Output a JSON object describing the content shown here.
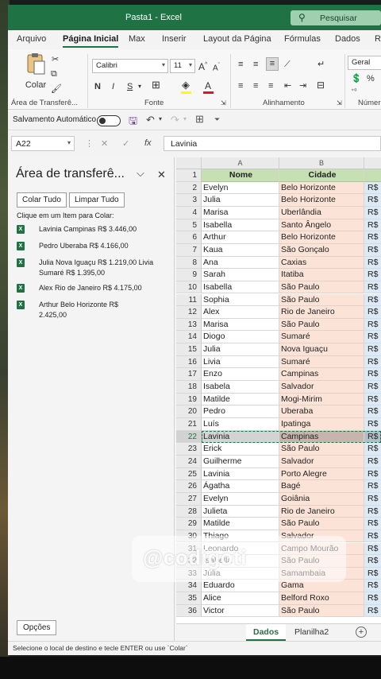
{
  "window": {
    "title": "Pasta1  -  Excel"
  },
  "search": {
    "label": "Pesquisar"
  },
  "ribbon_tabs": [
    "Arquivo",
    "Página Inicial",
    "Max",
    "Inserir",
    "Layout da Página",
    "Fórmulas",
    "Dados",
    "R"
  ],
  "ribbon": {
    "paste_label": "Colar",
    "font_name": "Calibri",
    "font_size": "11",
    "number_format": "Geral",
    "groups": {
      "clipboard": "Área de Transferê...",
      "font": "Fonte",
      "alignment": "Alinhamento",
      "number": "Número"
    },
    "bold": "N",
    "italic": "I",
    "underline": "S",
    "font_grow": "A",
    "font_shrink": "A",
    "font_color_letter": "A"
  },
  "qat": {
    "autosave_label": "Salvamento Automático"
  },
  "formula_bar": {
    "name_box": "A22",
    "cancel": "✕",
    "enter": "✓",
    "fx": "fx",
    "formula": "Lavinia"
  },
  "clipboard_pane": {
    "title": "Área de transferê...",
    "paste_all": "Colar Tudo",
    "clear_all": "Limpar Tudo",
    "hint": "Clique em um Item para Colar:",
    "items": [
      {
        "text": "Lavinia Campinas R$ 3.446,00"
      },
      {
        "text": "Pedro Uberaba R$ 4.166,00"
      },
      {
        "text": "Julia Nova Iguaçu R$ 1.219,00 Livia Sumaré R$ 1.395,00"
      },
      {
        "text": "Alex Rio de Janeiro R$ 4.175,00"
      },
      {
        "text": "Arthur Belo Horizonte R$ 2.425,00"
      }
    ],
    "options": "Opções"
  },
  "grid": {
    "columns": [
      "A",
      "B"
    ],
    "header": {
      "row": "1",
      "a": "Nome",
      "b": "Cidade"
    },
    "currency": "R$",
    "selected_row": "22",
    "rows": [
      {
        "n": "2",
        "a": "Evelyn",
        "b": "Belo Horizonte"
      },
      {
        "n": "3",
        "a": "Julia",
        "b": "Belo Horizonte"
      },
      {
        "n": "4",
        "a": "Marisa",
        "b": "Uberlândia"
      },
      {
        "n": "5",
        "a": "Isabella",
        "b": "Santo Ângelo"
      },
      {
        "n": "6",
        "a": "Arthur",
        "b": "Belo Horizonte"
      },
      {
        "n": "7",
        "a": "Kaua",
        "b": "São Gonçalo"
      },
      {
        "n": "8",
        "a": "Ana",
        "b": "Caxias"
      },
      {
        "n": "9",
        "a": "Sarah",
        "b": "Itatiba"
      },
      {
        "n": "10",
        "a": "Isabella",
        "b": "São Paulo"
      },
      {
        "n": "11",
        "a": "Sophia",
        "b": "São Paulo"
      },
      {
        "n": "12",
        "a": "Alex",
        "b": "Rio de Janeiro"
      },
      {
        "n": "13",
        "a": "Marisa",
        "b": "São Paulo"
      },
      {
        "n": "14",
        "a": "Diogo",
        "b": "Sumaré"
      },
      {
        "n": "15",
        "a": "Julia",
        "b": "Nova Iguaçu"
      },
      {
        "n": "16",
        "a": "Livia",
        "b": "Sumaré"
      },
      {
        "n": "17",
        "a": "Enzo",
        "b": "Campinas"
      },
      {
        "n": "18",
        "a": "Isabela",
        "b": "Salvador"
      },
      {
        "n": "19",
        "a": "Matilde",
        "b": "Mogi-Mirim"
      },
      {
        "n": "20",
        "a": "Pedro",
        "b": "Uberaba"
      },
      {
        "n": "21",
        "a": "Luís",
        "b": "Ipatinga"
      },
      {
        "n": "22",
        "a": "Lavinia",
        "b": "Campinas"
      },
      {
        "n": "23",
        "a": "Erick",
        "b": "São Paulo"
      },
      {
        "n": "24",
        "a": "Guilherme",
        "b": "Salvador"
      },
      {
        "n": "25",
        "a": "Lavinia",
        "b": "Porto Alegre"
      },
      {
        "n": "26",
        "a": "Ágatha",
        "b": "Bagé"
      },
      {
        "n": "27",
        "a": "Evelyn",
        "b": "Goiânia"
      },
      {
        "n": "28",
        "a": "Julieta",
        "b": "Rio de Janeiro"
      },
      {
        "n": "29",
        "a": "Matilde",
        "b": "São Paulo"
      },
      {
        "n": "30",
        "a": "Thiago",
        "b": "Salvador"
      },
      {
        "n": "31",
        "a": "Leonardo",
        "b": "Campo Mourão"
      },
      {
        "n": "32",
        "a": "Isabella",
        "b": "São Paulo"
      },
      {
        "n": "33",
        "a": "Júlia",
        "b": "Samambaia"
      },
      {
        "n": "34",
        "a": "Eduardo",
        "b": "Gama"
      },
      {
        "n": "35",
        "a": "Alice",
        "b": "Belford Roxo"
      },
      {
        "n": "36",
        "a": "Victor",
        "b": "São Paulo"
      }
    ]
  },
  "sheets": [
    "Dados",
    "Planilha2"
  ],
  "add_sheet": "+",
  "status_text": "Selecione o local de destino e tecle ENTER ou use `Colar`",
  "watermark": "@codigoti",
  "colors": {
    "excel_green": "#1f7244",
    "header_green": "#c6e0b4",
    "city_fill": "#fbe3d8",
    "value_fill": "#dde9f4"
  }
}
